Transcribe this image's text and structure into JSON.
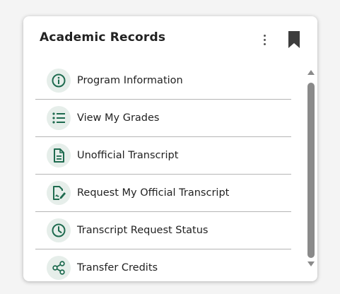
{
  "card": {
    "title": "Academic Records",
    "menu_icon": "more-vert-icon",
    "bookmark_icon": "bookmark-icon"
  },
  "colors": {
    "icon_green": "#1e6b4f",
    "icon_bg": "#e6eeea",
    "scroll_thumb": "#8a8a8a"
  },
  "items": [
    {
      "label": "Program Information",
      "icon": "info-icon"
    },
    {
      "label": "View My Grades",
      "icon": "list-icon"
    },
    {
      "label": "Unofficial Transcript",
      "icon": "document-icon"
    },
    {
      "label": "Request My Official Transcript",
      "icon": "signed-document-icon"
    },
    {
      "label": "Transcript Request Status",
      "icon": "clock-icon"
    },
    {
      "label": "Transfer Credits",
      "icon": "share-icon"
    }
  ]
}
